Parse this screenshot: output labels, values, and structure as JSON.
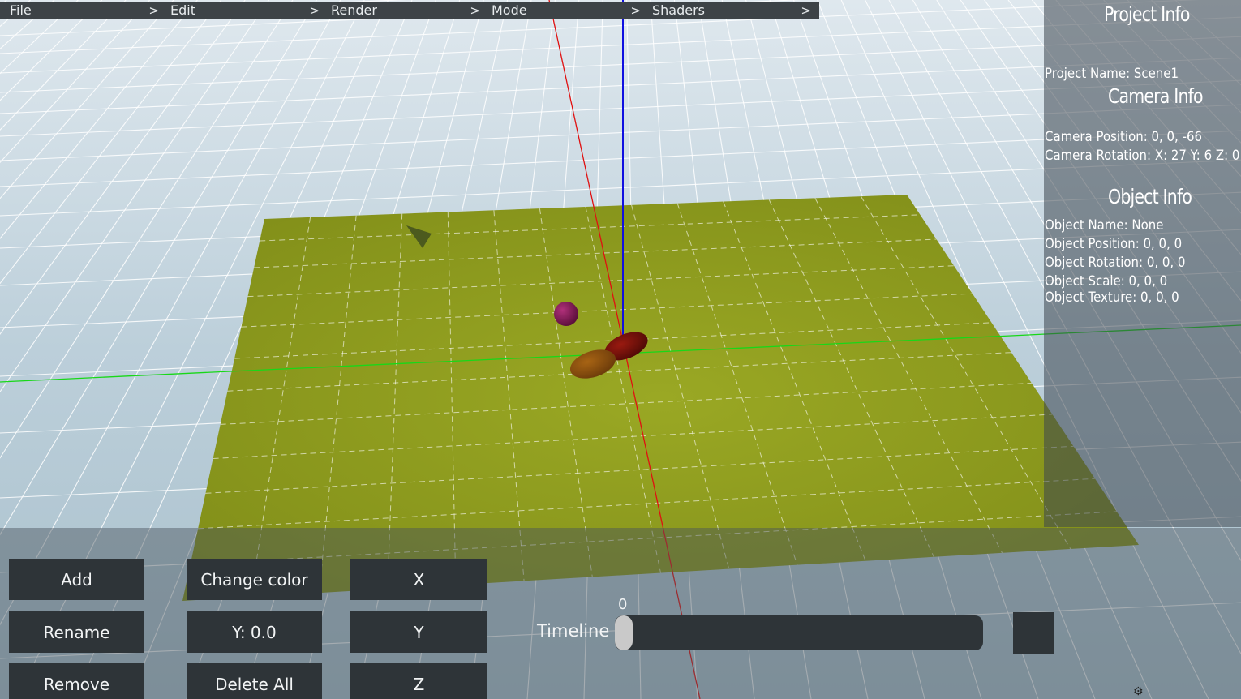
{
  "menu": {
    "items": [
      {
        "label": "File",
        "chevron": ">"
      },
      {
        "label": "Edit",
        "chevron": ">"
      },
      {
        "label": "Render",
        "chevron": ">"
      },
      {
        "label": "Mode",
        "chevron": ">"
      },
      {
        "label": "Shaders",
        "chevron": ">"
      }
    ]
  },
  "info_panel": {
    "project_title": "Project Info",
    "project_name": "Project Name: Scene1",
    "camera_title": "Camera Info",
    "camera_position": "Camera Position: 0, 0, -66",
    "camera_rotation": "Camera Rotation: X: 27 Y: 6 Z: 0",
    "object_title": "Object Info",
    "object_name": "Object Name: None",
    "object_position": "Object Position: 0, 0, 0",
    "object_rotation": "Object Rotation: 0, 0, 0",
    "object_scale": "Object Scale: 0, 0, 0",
    "object_texture": "Object Texture: 0, 0, 0"
  },
  "bottom": {
    "add": "Add",
    "rename": "Rename",
    "remove": "Remove",
    "change_color": "Change color",
    "y_value": "Y: 0.0",
    "delete_all": "Delete All",
    "x": "X",
    "y": "Y",
    "z": "Z",
    "timeline_label": "Timeline",
    "timeline_value": "0"
  },
  "colors": {
    "sky": "#b9cdd8",
    "ground": "#8a9a1c",
    "axis_x": "#e01010",
    "axis_y": "#1010e0",
    "axis_z": "#10d010"
  }
}
